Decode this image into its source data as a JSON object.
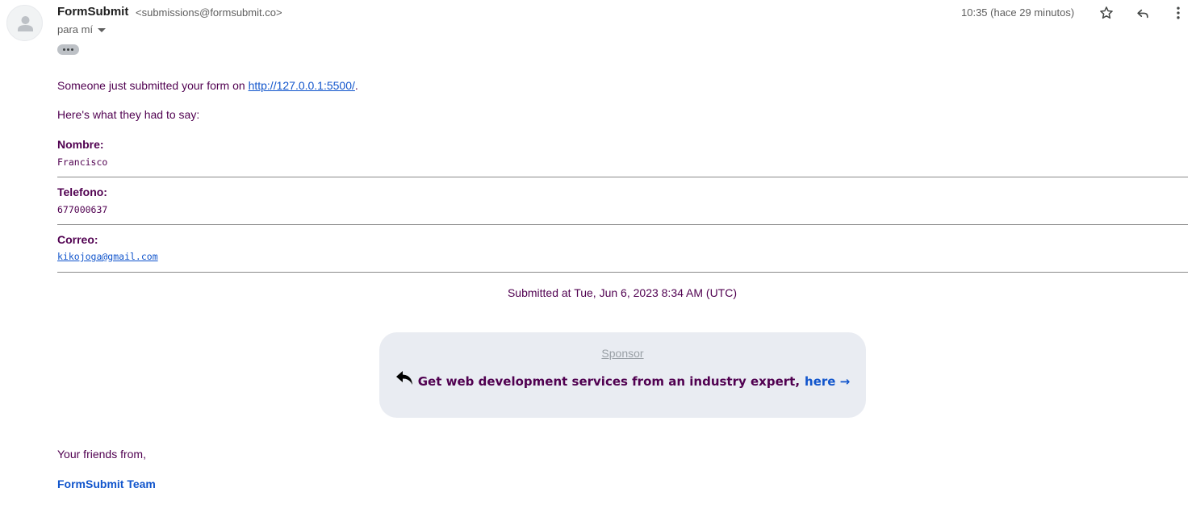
{
  "email": {
    "sender_name": "FormSubmit",
    "sender_email": "<submissions@formsubmit.co>",
    "recipient": "para mí",
    "timestamp": "10:35 (hace 29 minutos)"
  },
  "icons": {
    "avatar": "person-avatar-icon",
    "star": "star-outline-icon",
    "reply": "reply-icon",
    "more": "more-vert-icon",
    "caret": "chevron-down-icon",
    "sponsor_arrow": "reply-arrow-icon"
  },
  "content": {
    "intro_prefix": "Someone just submitted your form on ",
    "intro_link": "http://127.0.0.1:5500/",
    "intro_suffix": ".",
    "prompt": "Here's what they had to say:",
    "fields": [
      {
        "label": "Nombre:",
        "value": "Francisco"
      },
      {
        "label": "Telefono:",
        "value": "677000637"
      },
      {
        "label": "Correo:",
        "value": "kikojoga@gmail.com"
      }
    ],
    "submitted_at": "Submitted at Tue, Jun 6, 2023 8:34 AM (UTC)",
    "sponsor_label": "Sponsor",
    "sponsor_text": "Get web development services from an industry expert,",
    "sponsor_link": "here →",
    "closing": "Your friends from,",
    "signature": "FormSubmit Team"
  },
  "colors": {
    "body_text": "#500050",
    "link": "#1155cc",
    "sponsor_bg": "#e9ecf2"
  }
}
